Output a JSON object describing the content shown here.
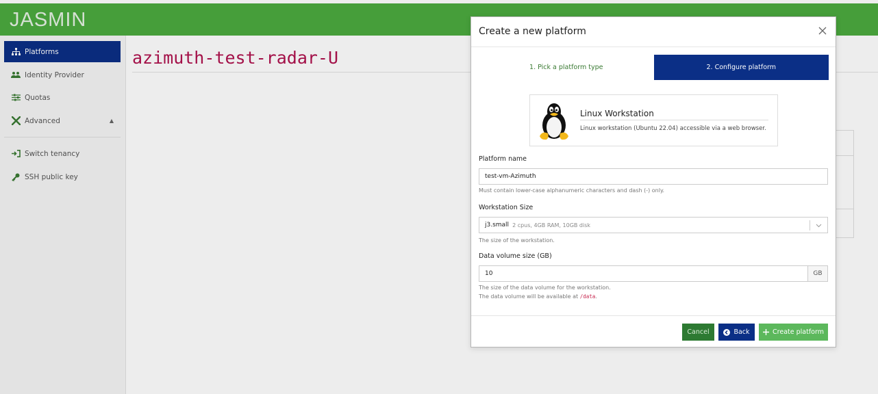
{
  "app": {
    "brand": "JASMIN"
  },
  "sidebar": {
    "items": [
      {
        "label": "Platforms",
        "icon": "sitemap-icon"
      },
      {
        "label": "Identity Provider",
        "icon": "users-icon"
      },
      {
        "label": "Quotas",
        "icon": "sliders-icon"
      },
      {
        "label": "Advanced",
        "icon": "tools-icon"
      },
      {
        "label": "Switch tenancy",
        "icon": "sign-in-icon"
      },
      {
        "label": "SSH public key",
        "icon": "key-icon"
      }
    ]
  },
  "page": {
    "title": "azimuth-test-radar-U"
  },
  "modal": {
    "title": "Create a new platform",
    "steps": [
      {
        "label": "1. Pick a platform type"
      },
      {
        "label": "2. Configure platform"
      }
    ],
    "platform": {
      "name": "Linux Workstation",
      "description": "Linux workstation (Ubuntu 22.04) accessible via a web browser."
    },
    "fields": {
      "name": {
        "label": "Platform name",
        "value": "test-vm-Azimuth",
        "help": "Must contain lower-case alphanumeric characters and dash (-) only."
      },
      "size": {
        "label": "Workstation Size",
        "value": "j3.small",
        "detail": "2 cpus, 4GB RAM, 10GB disk",
        "help": "The size of the workstation."
      },
      "volume": {
        "label": "Data volume size (GB)",
        "value": "10",
        "unit": "GB",
        "help1": "The size of the data volume for the workstation.",
        "help2_prefix": "The data volume will be available at ",
        "help2_code": "/data",
        "help2_suffix": "."
      }
    },
    "buttons": {
      "cancel": "Cancel",
      "back": "Back",
      "create": "Create platform"
    }
  },
  "colors": {
    "brand_green": "#4caa3f",
    "navy": "#0b2f86",
    "title_magenta": "#b0124e",
    "create_green": "#5cb85c"
  }
}
